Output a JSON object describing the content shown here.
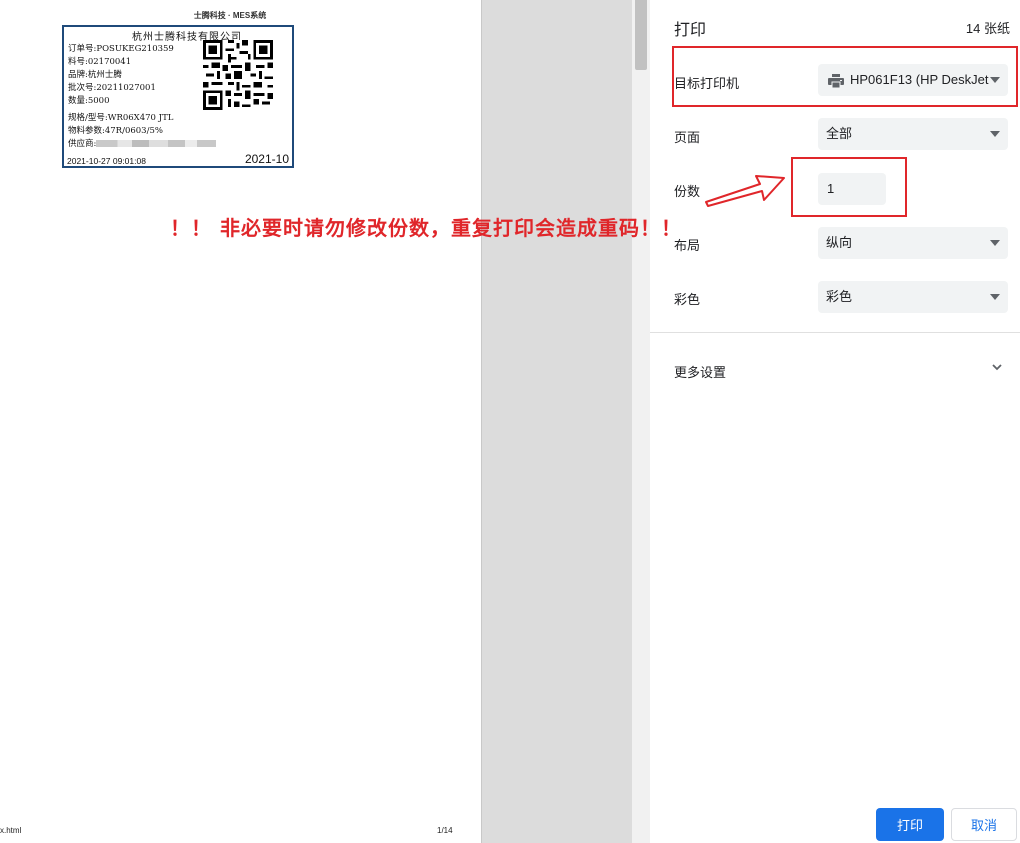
{
  "preview": {
    "header": "士腾科技 · MES系统",
    "footer_left": "x.html",
    "footer_right": "1/14",
    "label": {
      "company": "杭州士腾科技有限公司",
      "order_no": "订单号:POSUKEG210359",
      "material_no": "料号:02170041",
      "brand": "品牌:杭州士腾",
      "batch_no": "批次号:20211027001",
      "quantity": "数量:5000",
      "spec": "规格/型号:WR06X470 JTL",
      "params": "物料参数:47R/0603/5%",
      "supplier": "供应商:",
      "datetime": "2021-10-27 09:01:08",
      "batch_short": "2021-10"
    }
  },
  "settings": {
    "title": "打印",
    "sheets": "14 张纸",
    "destination": {
      "label": "目标打印机",
      "value": "HP061F13 (HP DeskJet"
    },
    "pages": {
      "label": "页面",
      "value": "全部"
    },
    "copies": {
      "label": "份数",
      "value": "1"
    },
    "layout": {
      "label": "布局",
      "value": "纵向"
    },
    "color": {
      "label": "彩色",
      "value": "彩色"
    },
    "more": "更多设置",
    "print_button": "打印",
    "cancel_button": "取消"
  },
  "annotation": {
    "warning": "！！ 非必要时请勿修改份数，重复打印会造成重码！！"
  },
  "colors": {
    "accent": "#1a73e8",
    "annotation": "#e0262a",
    "label_border": "#1f4a7a"
  }
}
